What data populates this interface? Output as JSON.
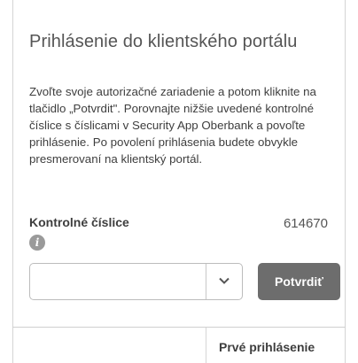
{
  "panel": {
    "title": "Prihlásenie do klientského portálu",
    "description": "Zvoľte svoje autorizačné zariadenie a potom kliknite na tlačidlo „Potvrdit\". Porovnajte nižšie uvedené kontrolné číslice s číslicami v Security App Oberbank a povoľte prihlásenie. Po povolení prihlásenia budete obvykle presmerovaní na klientský portál.",
    "control_label": "Kontrolné číslice",
    "control_value": "614670",
    "info_icon_glyph": "i",
    "device_select_value": "",
    "confirm_button": "Potvrdiť"
  },
  "table": {
    "header": "Prvé prihlásenie"
  },
  "colors": {
    "button_bg": "#6d6d6d",
    "border": "#d4d4d4"
  }
}
